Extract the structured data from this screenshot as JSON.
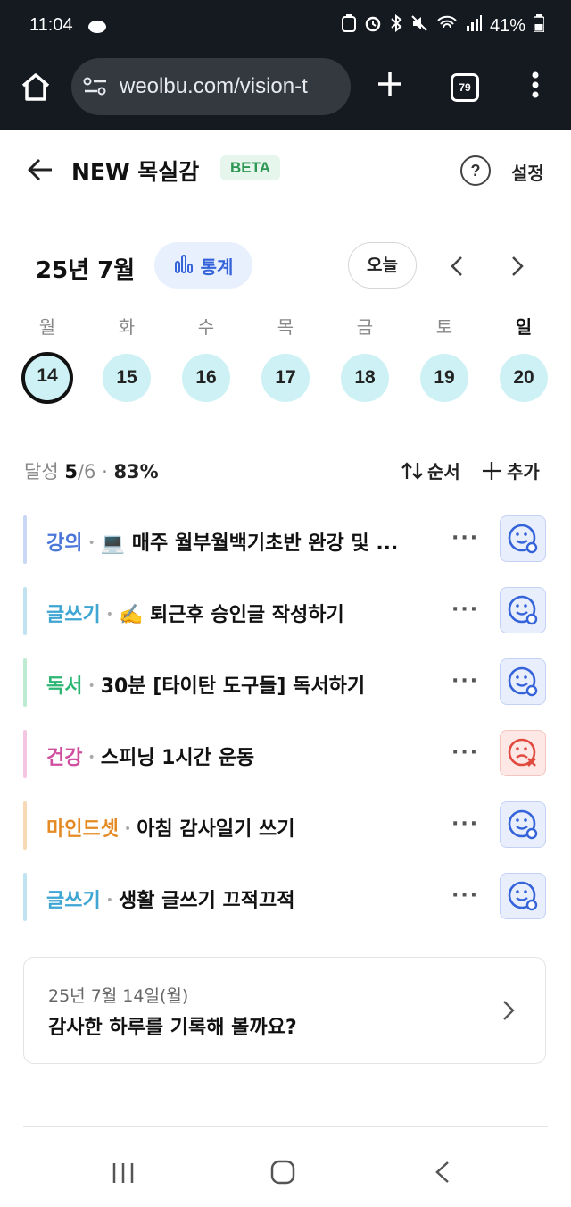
{
  "status_bar": {
    "time": "11:04",
    "battery": "41%"
  },
  "browser": {
    "url": "weolbu.com/vision-t",
    "tab_count": "79"
  },
  "header": {
    "title": "NEW 목실감",
    "badge": "BETA",
    "settings_label": "설정"
  },
  "calendar": {
    "month_label": "25년 7월",
    "stats_label": "통계",
    "today_label": "오늘",
    "weekdays": [
      "월",
      "화",
      "수",
      "목",
      "금",
      "토",
      "일"
    ],
    "days": [
      "14",
      "15",
      "16",
      "17",
      "18",
      "19",
      "20"
    ],
    "selected_day": "14"
  },
  "summary": {
    "label": "달성",
    "done": "5",
    "total": "6",
    "percent": "83%",
    "sort_label": "순서",
    "add_label": "추가"
  },
  "colors": {
    "accent": "#3563d9",
    "fail": "#e04a3f",
    "day_bg": "#cdf1f4"
  },
  "tasks": [
    {
      "category": "강의",
      "name": "💻 매주 월부월백기초반 완강 및 ...",
      "cat_color": "#4a76d9",
      "bar_color": "#c9d6f6",
      "status": "success"
    },
    {
      "category": "글쓰기",
      "name": "✍️ 퇴근후 승인글 작성하기",
      "cat_color": "#3fa6d3",
      "bar_color": "#bfe3f1",
      "status": "success"
    },
    {
      "category": "독서",
      "name": "30분 [타이탄 도구들] 독서하기",
      "cat_color": "#2bb673",
      "bar_color": "#bcebd2",
      "status": "success"
    },
    {
      "category": "건강",
      "name": "스피닝 1시간 운동",
      "cat_color": "#d04ea0",
      "bar_color": "#f5c6e3",
      "status": "fail"
    },
    {
      "category": "마인드셋",
      "name": "아침 감사일기 쓰기",
      "cat_color": "#e58b25",
      "bar_color": "#f8d9b5",
      "status": "success"
    },
    {
      "category": "글쓰기",
      "name": "생활 글쓰기 끄적끄적",
      "cat_color": "#3fa6d3",
      "bar_color": "#bfe3f1",
      "status": "success"
    }
  ],
  "gratitude": {
    "date": "25년 7월 14일(월)",
    "prompt": "감사한 하루를 기록해 볼까요?"
  }
}
